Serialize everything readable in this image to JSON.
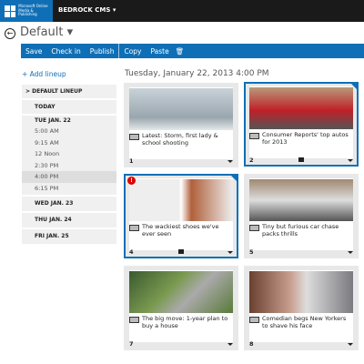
{
  "header": {
    "logo_text": "Microsoft Online Media & Publishing",
    "app_title": "BEDROCK CMS ▾"
  },
  "page": {
    "title": "Default ▾",
    "back_icon": "←"
  },
  "toolbar": {
    "save": "Save",
    "check_in": "Check in",
    "publish": "Publish",
    "copy": "Copy",
    "paste": "Paste",
    "delete_icon": "🗑"
  },
  "sidebar": {
    "add_lineup": "+ Add lineup",
    "default_lineup": "> DEFAULT LINEUP",
    "today": "TODAY",
    "days": [
      {
        "label": "TUE JAN. 22",
        "times": [
          "5:00 AM",
          "9:15 AM",
          "12 Noon",
          "2:30 PM",
          "4:00 PM",
          "6:15 PM"
        ]
      },
      {
        "label": "WED JAN. 23"
      },
      {
        "label": "THU JAN. 24"
      },
      {
        "label": "FRI JAN. 25"
      }
    ],
    "selected_time": "4:00 PM"
  },
  "main": {
    "date": "Tuesday, January 22, 2013 4:00 PM",
    "cards": [
      {
        "num": "1",
        "title": "Latest: Storm, first lady & school shooting",
        "locked": false,
        "selected": false
      },
      {
        "num": "2",
        "title": "Consumer Reports' top autos for 2013",
        "locked": true,
        "selected": true
      },
      {
        "num": "4",
        "title": "The wackiest shoes we've ever seen",
        "locked": true,
        "selected": true,
        "alert": "!"
      },
      {
        "num": "5",
        "title": "Tiny but furious car chase packs thrills",
        "locked": false,
        "selected": false
      },
      {
        "num": "7",
        "title": "The big move: 1-year plan to buy a house",
        "locked": false,
        "selected": false
      },
      {
        "num": "8",
        "title": "Comedian begs New Yorkers to shave his face",
        "locked": false,
        "selected": false
      }
    ]
  },
  "colors": {
    "accent": "#0f6fb6",
    "topbar": "#1a1a1a",
    "alert": "#dd0000"
  }
}
